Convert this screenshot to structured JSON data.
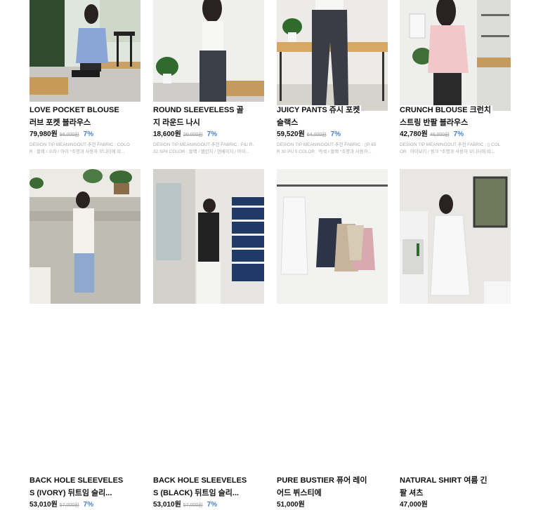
{
  "products": [
    {
      "title_l1": "LOVE POCKET BLOUSE",
      "title_l2": "러브 포켓 블라우스",
      "sale_price": "79,980원",
      "original_price": "86,000원",
      "discount": "7%",
      "desc_l1": "DESIGN TIP MEANINGOUT 추천 FABRIC : COLO",
      "desc_l2": "R : 블랙 / 소라 / 아이 *조명과 사용자 모니터에 따..."
    },
    {
      "title_l1": "ROUND SLEEVELESS 골",
      "title_l2": "지 라운드 나시",
      "sale_price": "18,600원",
      "original_price": "20,000원",
      "discount": "7%",
      "desc_l1": "DESIGN TIP MEANINGOUT 추천 FABRIC : P&I R.",
      "desc_l2": "32 SP8 COLOR : 블랙 / 멜란지 / 연베이지 / 아이..."
    },
    {
      "title_l1": "JUICY PANTS 쥬시 포켓",
      "title_l2": "슬랙스",
      "sale_price": "59,520원",
      "original_price": "64,000원",
      "discount": "7%",
      "desc_l1": "DESIGN TIP MEANINGOUT 추천 FABRIC : ▯P 65",
      "desc_l2": "R 30 PU 5 COLOR : 먹색 / 블랙 *조명과 사용자..."
    },
    {
      "title_l1": "CRUNCH BLOUSE 크런치",
      "title_l2": "스트링 반팔 블라우스",
      "sale_price": "42,780원",
      "original_price": "46,000원",
      "discount": "7%",
      "desc_l1": "DESIGN TIP MEANINGOUT 추천 FABRIC : ▯ COL",
      "desc_l2": "OR : 아이보리 / 핑크 *조명과 사용자 모니터에 따..."
    },
    {
      "title_l1": "BACK HOLE SLEEVELES",
      "title_l2": "S (IVORY) 뒤트임 슬리...",
      "sale_price": "53,010원",
      "original_price": "57,000원",
      "discount": "7%"
    },
    {
      "title_l1": "BACK HOLE SLEEVELES",
      "title_l2": "S (BLACK) 뒤트임 슬리...",
      "sale_price": "53,010원",
      "original_price": "57,000원",
      "discount": "7%"
    },
    {
      "title_l1": "PURE BUSTIER 퓨어 레이",
      "title_l2": "어드 뷔스티에",
      "sale_price": "51,000원",
      "original_price": "",
      "discount": ""
    },
    {
      "title_l1": "NATURAL SHIRT 여름 긴",
      "title_l2": "팔 셔츠",
      "sale_price": "47,000원",
      "original_price": "",
      "discount": ""
    }
  ],
  "photos": [
    {
      "scene": "woman-blue-top-sitting-bench",
      "bg": "#e7ece7",
      "accent": "#8aa6d8"
    },
    {
      "scene": "woman-white-sleeveless-plant",
      "bg": "#f0f0ee",
      "accent": "#3b3f47"
    },
    {
      "scene": "woman-dark-slacks-table",
      "bg": "#ececea",
      "accent": "#3a3d45"
    },
    {
      "scene": "woman-pink-blouse-room",
      "bg": "#eeeeec",
      "accent": "#f1c7c9"
    },
    {
      "scene": "woman-white-sleeveless-street",
      "bg": "#d9d8d2",
      "accent": "#f4f2ec"
    },
    {
      "scene": "woman-black-sleeveless-boxes",
      "bg": "#e8e6e2",
      "accent": "#222222"
    },
    {
      "scene": "bustiers-on-hangers",
      "bg": "#f2f2f0",
      "accent": "#2d3447"
    },
    {
      "scene": "woman-white-shirt-room",
      "bg": "#e8e6e2",
      "accent": "#f8f8f8"
    }
  ],
  "colors": {
    "discount": "#4a7fd6",
    "price": "#111111",
    "strike": "#999999",
    "desc": "#aaaaaa"
  }
}
